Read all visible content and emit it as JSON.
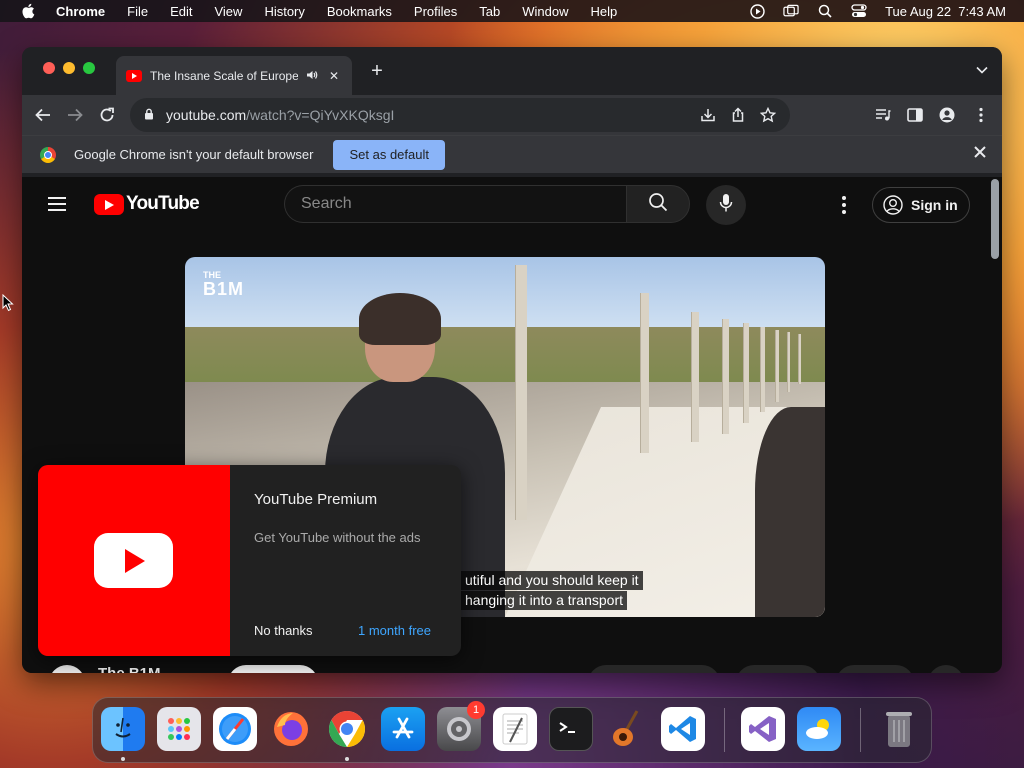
{
  "menubar": {
    "app": "Chrome",
    "menus": [
      "File",
      "Edit",
      "View",
      "History",
      "Bookmarks",
      "Profiles",
      "Tab",
      "Window",
      "Help"
    ],
    "datetime": "Tue Aug 22  7:43 AM"
  },
  "browser": {
    "tab": {
      "title": "The Insane Scale of Europe",
      "icon": "youtube-favicon-icon"
    },
    "url": {
      "host": "youtube.com",
      "path": "/watch?v=QiYvXKQksgI"
    },
    "infobar": {
      "message": "Google Chrome isn't your default browser",
      "button": "Set as default"
    }
  },
  "youtube": {
    "logo": "YouTube",
    "search_placeholder": "Search",
    "sign_in": "Sign in",
    "video": {
      "watermark_small": "THE",
      "watermark_big": "B1M",
      "caption_line1": "utiful and you should keep it",
      "caption_line2": "hanging it into a transport"
    },
    "channel_name_partial": "The B1M"
  },
  "premium_popup": {
    "title": "YouTube Premium",
    "subtitle": "Get YouTube without the ads",
    "dismiss": "No thanks",
    "cta": "1 month free"
  },
  "dock": {
    "apps": [
      "Finder",
      "Launchpad",
      "Safari",
      "Firefox",
      "Chrome",
      "App Store",
      "System Settings",
      "TextEdit",
      "Terminal",
      "GarageBand",
      "Visual Studio Code",
      "Visual Studio",
      "Weather",
      "Trash"
    ],
    "settings_badge": "1"
  },
  "colors": {
    "youtube_red": "#ff0000",
    "link_blue": "#3ea6ff",
    "chrome_blue": "#8ab4f8"
  }
}
